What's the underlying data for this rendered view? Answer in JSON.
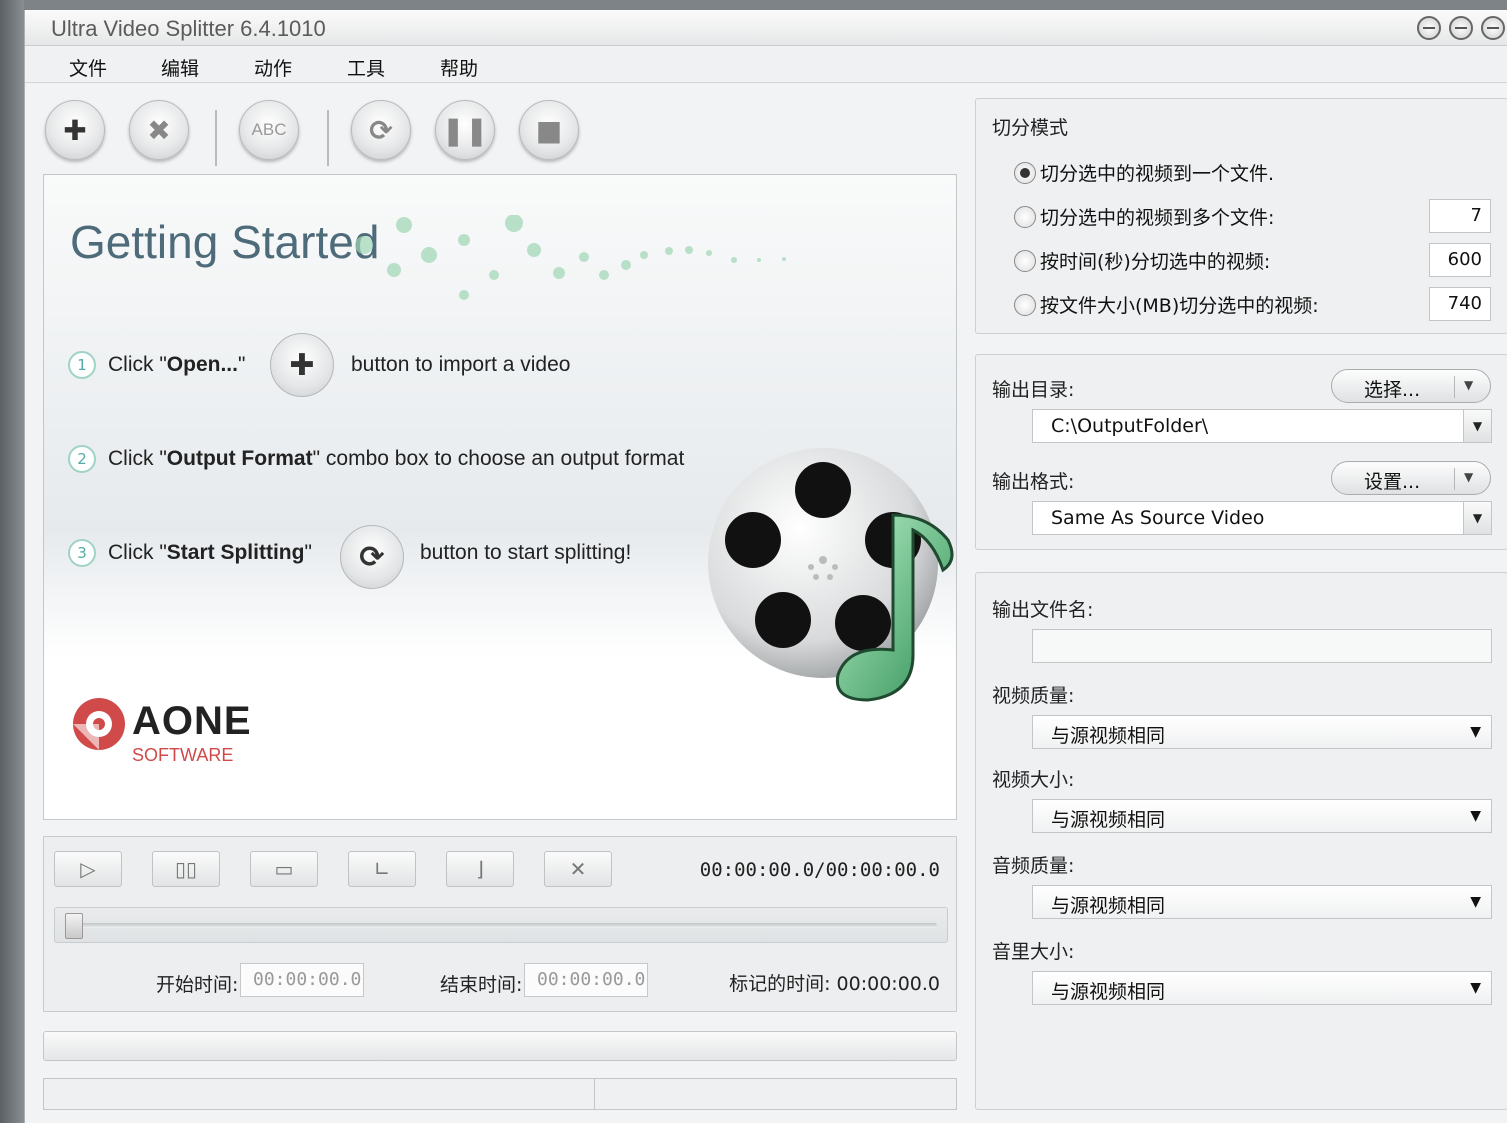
{
  "window": {
    "title": "Ultra Video Splitter 6.4.1010"
  },
  "menu": [
    "文件",
    "编辑",
    "动作",
    "工具",
    "帮助"
  ],
  "toolbar": {
    "format_btn_text": "ABC"
  },
  "getting_started": {
    "title": "Getting Started",
    "steps": [
      {
        "num": "1",
        "pre": "Click \"",
        "bold": "Open...",
        "post": "\"",
        "after": "button to import a video"
      },
      {
        "num": "2",
        "pre": "Click \"",
        "bold": "Output Format",
        "post": "\" combo box to choose an output format",
        "after": ""
      },
      {
        "num": "3",
        "pre": "Click \"",
        "bold": "Start Splitting",
        "post": "\"",
        "after": "button to start splitting!"
      }
    ],
    "logo_brand": "AONE",
    "logo_sub": "SOFTWARE"
  },
  "player": {
    "time": "00:00:00.0/00:00:00.0",
    "start_label": "开始时间:",
    "start_value": "00:00:00.0",
    "end_label": "结束时间:",
    "end_value": "00:00:00.0",
    "mark_label": "标记的时间: 00:00:00.0",
    "position": 0
  },
  "split_mode": {
    "title": "切分模式",
    "options": [
      {
        "label": "切分选中的视频到一个文件.",
        "selected": true,
        "value": ""
      },
      {
        "label": "切分选中的视频到多个文件:",
        "selected": false,
        "value": "7"
      },
      {
        "label": "按时间(秒)分切选中的视频:",
        "selected": false,
        "value": "600"
      },
      {
        "label": "按文件大小(MB)切分选中的视频:",
        "selected": false,
        "value": "740"
      }
    ]
  },
  "output": {
    "dir_label": "输出目录:",
    "dir_button": "选择...",
    "dir_value": "C:\\OutputFolder\\",
    "format_label": "输出格式:",
    "format_button": "设置...",
    "format_value": "Same As Source Video"
  },
  "settings": {
    "filename_label": "输出文件名:",
    "filename_value": "",
    "video_quality_label": "视频质量:",
    "video_quality_value": "与源视频相同",
    "video_size_label": "视频大小:",
    "video_size_value": "与源视频相同",
    "audio_quality_label": "音频质量:",
    "audio_quality_value": "与源视频相同",
    "volume_label": "音里大小:",
    "volume_value": "与源视频相同"
  },
  "colors": {
    "accent_teal": "#4e6b7a",
    "brand_red": "#d04a4a",
    "note_green": "#3fa86a"
  }
}
